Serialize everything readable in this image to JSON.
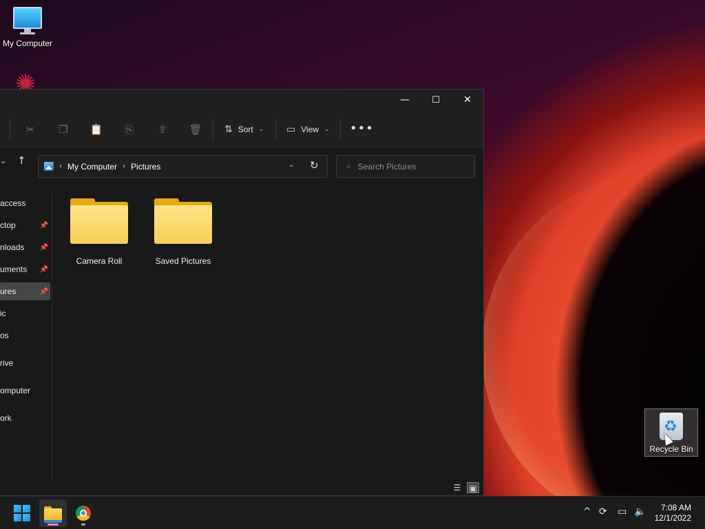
{
  "desktop": {
    "icons": [
      {
        "label": "My Computer",
        "icon": "monitor-icon"
      },
      {
        "label": "Recycle Bin",
        "icon": "recycle-bin-icon"
      }
    ]
  },
  "window": {
    "controls": {
      "minimize": "—",
      "maximize": "☐",
      "close": "✕"
    },
    "toolbar": {
      "sort_label": "Sort",
      "view_label": "View",
      "more_label": "•••",
      "icons": [
        "cut-icon",
        "copy-icon",
        "paste-icon",
        "rename-icon",
        "share-icon",
        "delete-icon"
      ]
    },
    "address": {
      "segments": [
        "My Computer",
        "Pictures"
      ],
      "separator": "›"
    },
    "search": {
      "placeholder": "Search Pictures"
    },
    "sidebar": {
      "items": [
        {
          "label": "access",
          "pinned": false
        },
        {
          "label": "ctop",
          "pinned": true
        },
        {
          "label": "nloads",
          "pinned": true
        },
        {
          "label": "uments",
          "pinned": true
        },
        {
          "label": "ures",
          "pinned": true,
          "selected": true
        },
        {
          "label": "ic",
          "pinned": false
        },
        {
          "label": "os",
          "pinned": false
        },
        {
          "label": "rive",
          "pinned": false
        },
        {
          "label": "omputer",
          "pinned": false
        },
        {
          "label": "ork",
          "pinned": false
        }
      ]
    },
    "content": {
      "folders": [
        {
          "name": "Camera Roll"
        },
        {
          "name": "Saved Pictures"
        }
      ]
    },
    "statusbar": {
      "view_details": "☰",
      "view_tiles": "▣"
    }
  },
  "taskbar": {
    "apps": [
      {
        "name": "File Explorer",
        "icon": "file-explorer-icon",
        "active": true
      },
      {
        "name": "Google Chrome",
        "icon": "chrome-icon",
        "active": false
      }
    ],
    "tray": {
      "chevron": "^",
      "sync": "⟳",
      "network": "▭",
      "volume": "🔈"
    },
    "clock": {
      "time": "7:08 AM",
      "date": "12/1/2022"
    }
  }
}
